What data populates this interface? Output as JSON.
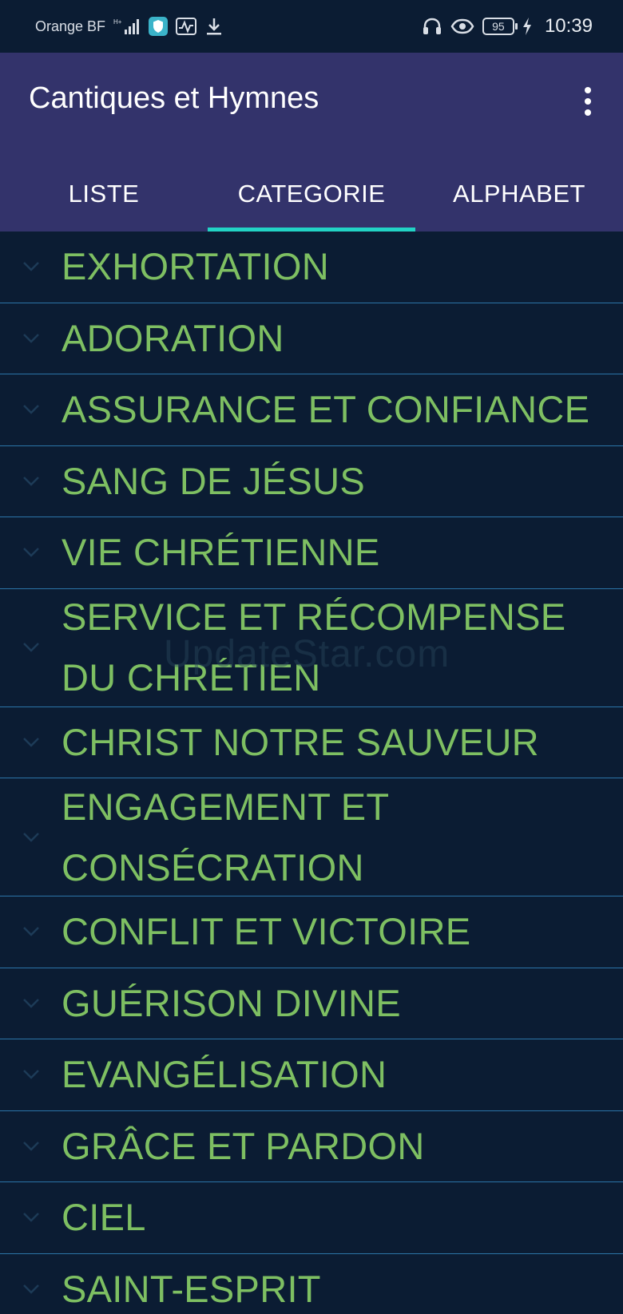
{
  "status_bar": {
    "carrier": "Orange BF",
    "battery": "95",
    "time": "10:39"
  },
  "app_bar": {
    "title": "Cantiques et Hymnes",
    "menu_icon": "more-vertical-icon"
  },
  "tabs": [
    {
      "label": "LISTE",
      "active": false
    },
    {
      "label": "CATEGORIE",
      "active": true
    },
    {
      "label": "ALPHABET",
      "active": false
    }
  ],
  "categories": [
    "EXHORTATION",
    "ADORATION",
    "ASSURANCE ET CONFIANCE",
    "SANG DE JÉSUS",
    "VIE CHRÉTIENNE",
    "SERVICE ET RÉCOMPENSE DU CHRÉTIEN",
    "CHRIST NOTRE SAUVEUR",
    "ENGAGEMENT ET CONSÉCRATION",
    "CONFLIT ET VICTOIRE",
    "GUÉRISON DIVINE",
    "EVANGÉLISATION",
    "GRÂCE ET PARDON",
    "CIEL",
    "SAINT-ESPRIT"
  ],
  "watermark": "UpdateStar.com",
  "colors": {
    "background": "#0b1c33",
    "app_bar": "#33336b",
    "tab_indicator": "#22d3c5",
    "category_text": "#7ebf62",
    "divider": "#2b74a8"
  }
}
